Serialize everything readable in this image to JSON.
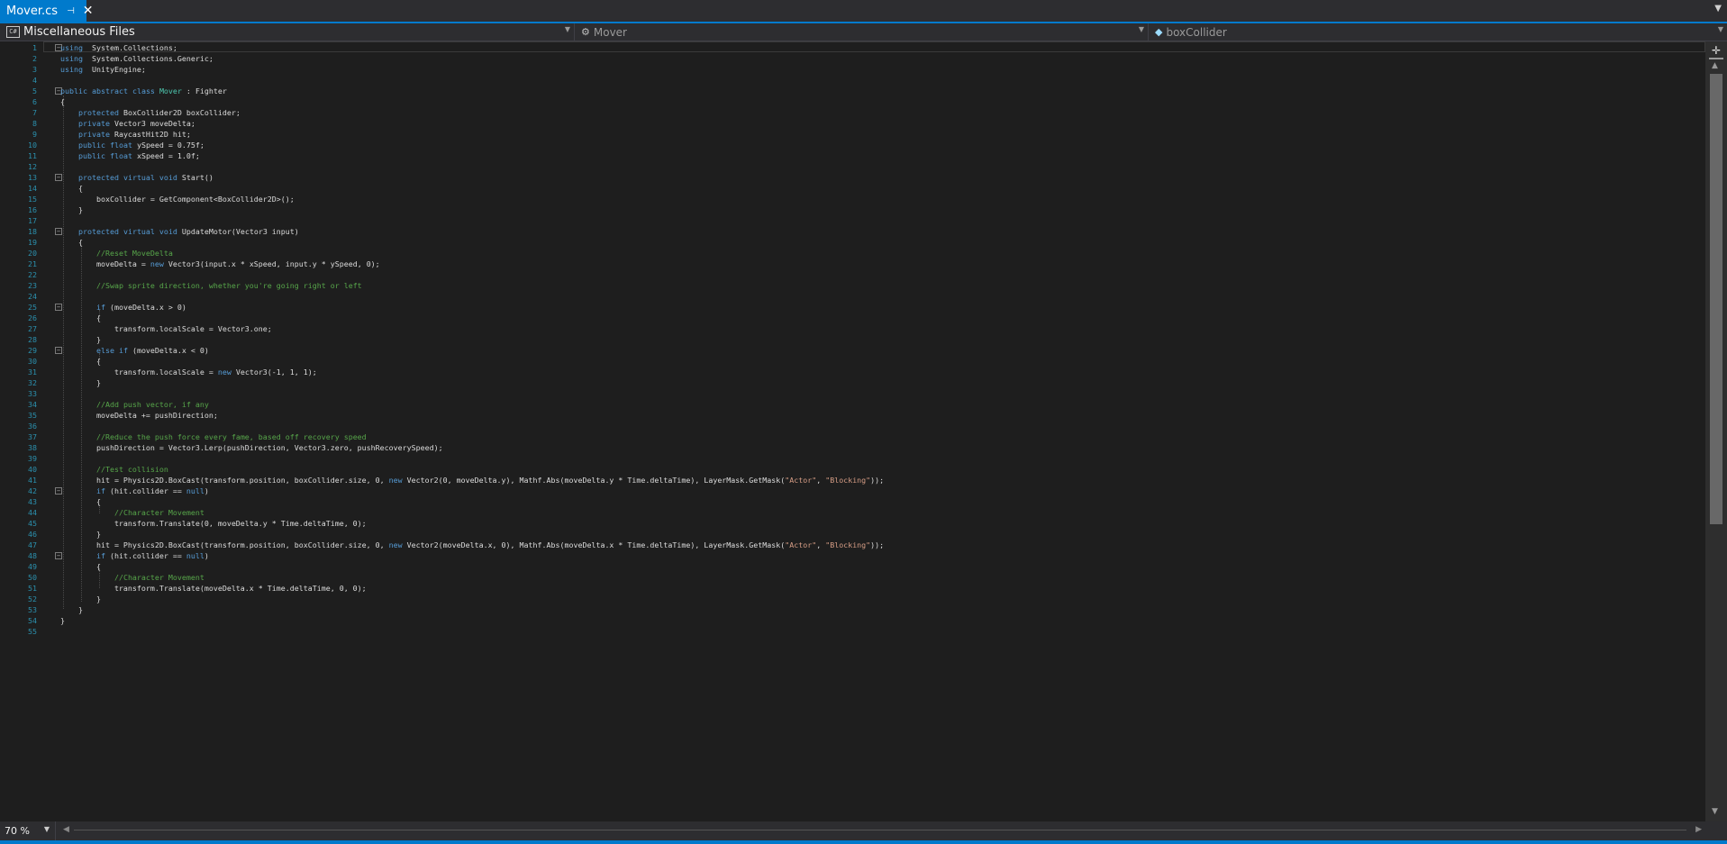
{
  "tab": {
    "title": "Mover.cs",
    "pin_icon": "pin-icon",
    "close_icon": "close-icon"
  },
  "nav": {
    "project": "Miscellaneous Files",
    "type": "Mover",
    "member": "boxCollider"
  },
  "zoom": {
    "value": "70 %"
  },
  "code_lines": [
    [
      [
        "kw",
        "using"
      ],
      [
        "",
        "  System.Collections;"
      ]
    ],
    [
      [
        "kw",
        "using"
      ],
      [
        "",
        "  System.Collections.Generic;"
      ]
    ],
    [
      [
        "kw",
        "using"
      ],
      [
        "",
        "  UnityEngine;"
      ]
    ],
    [],
    [
      [
        "kw",
        "public"
      ],
      [
        "",
        " "
      ],
      [
        "kw",
        "abstract"
      ],
      [
        "",
        " "
      ],
      [
        "kw",
        "class"
      ],
      [
        "",
        " "
      ],
      [
        "ty",
        "Mover"
      ],
      [
        "",
        " : Fighter"
      ]
    ],
    [
      [
        "",
        "{"
      ]
    ],
    [
      [
        "",
        "    "
      ],
      [
        "kw",
        "protected"
      ],
      [
        "",
        " BoxCollider2D boxCollider;"
      ]
    ],
    [
      [
        "",
        "    "
      ],
      [
        "kw",
        "private"
      ],
      [
        "",
        " Vector3 moveDelta;"
      ]
    ],
    [
      [
        "",
        "    "
      ],
      [
        "kw",
        "private"
      ],
      [
        "",
        " RaycastHit2D hit;"
      ]
    ],
    [
      [
        "",
        "    "
      ],
      [
        "kw",
        "public"
      ],
      [
        "",
        " "
      ],
      [
        "kw",
        "float"
      ],
      [
        "",
        " ySpeed = 0.75f;"
      ]
    ],
    [
      [
        "",
        "    "
      ],
      [
        "kw",
        "public"
      ],
      [
        "",
        " "
      ],
      [
        "kw",
        "float"
      ],
      [
        "",
        " xSpeed = 1.0f;"
      ]
    ],
    [],
    [
      [
        "",
        "    "
      ],
      [
        "kw",
        "protected"
      ],
      [
        "",
        " "
      ],
      [
        "kw",
        "virtual"
      ],
      [
        "",
        " "
      ],
      [
        "kw",
        "void"
      ],
      [
        "",
        " Start()"
      ]
    ],
    [
      [
        "",
        "    {"
      ]
    ],
    [
      [
        "",
        "        boxCollider = GetComponent<BoxCollider2D>();"
      ]
    ],
    [
      [
        "",
        "    }"
      ]
    ],
    [],
    [
      [
        "",
        "    "
      ],
      [
        "kw",
        "protected"
      ],
      [
        "",
        " "
      ],
      [
        "kw",
        "virtual"
      ],
      [
        "",
        " "
      ],
      [
        "kw",
        "void"
      ],
      [
        "",
        " UpdateMotor(Vector3 input)"
      ]
    ],
    [
      [
        "",
        "    {"
      ]
    ],
    [
      [
        "",
        "        "
      ],
      [
        "cm",
        "//Reset MoveDelta"
      ]
    ],
    [
      [
        "",
        "        moveDelta = "
      ],
      [
        "kw",
        "new"
      ],
      [
        "",
        " Vector3(input.x * xSpeed, input.y * ySpeed, 0);"
      ]
    ],
    [],
    [
      [
        "",
        "        "
      ],
      [
        "cm",
        "//Swap sprite direction, whether you're going right or left"
      ]
    ],
    [],
    [
      [
        "",
        "        "
      ],
      [
        "kw",
        "if"
      ],
      [
        "",
        " (moveDelta.x > 0)"
      ]
    ],
    [
      [
        "",
        "        {"
      ]
    ],
    [
      [
        "",
        "            transform.localScale = Vector3.one;"
      ]
    ],
    [
      [
        "",
        "        }"
      ]
    ],
    [
      [
        "",
        "        "
      ],
      [
        "kw",
        "else"
      ],
      [
        "",
        " "
      ],
      [
        "kw",
        "if"
      ],
      [
        "",
        " (moveDelta.x < 0)"
      ]
    ],
    [
      [
        "",
        "        {"
      ]
    ],
    [
      [
        "",
        "            transform.localScale = "
      ],
      [
        "kw",
        "new"
      ],
      [
        "",
        " Vector3(-1, 1, 1);"
      ]
    ],
    [
      [
        "",
        "        }"
      ]
    ],
    [],
    [
      [
        "",
        "        "
      ],
      [
        "cm",
        "//Add push vector, if any"
      ]
    ],
    [
      [
        "",
        "        moveDelta += pushDirection;"
      ]
    ],
    [],
    [
      [
        "",
        "        "
      ],
      [
        "cm",
        "//Reduce the push force every fame, based off recovery speed"
      ]
    ],
    [
      [
        "",
        "        pushDirection = Vector3.Lerp(pushDirection, Vector3.zero, pushRecoverySpeed);"
      ]
    ],
    [],
    [
      [
        "",
        "        "
      ],
      [
        "cm",
        "//Test collision"
      ]
    ],
    [
      [
        "",
        "        hit = Physics2D.BoxCast(transform.position, boxCollider.size, 0, "
      ],
      [
        "kw",
        "new"
      ],
      [
        "",
        " Vector2(0, moveDelta.y), Mathf.Abs(moveDelta.y * Time.deltaTime), LayerMask.GetMask("
      ],
      [
        "st",
        "\"Actor\""
      ],
      [
        "",
        ", "
      ],
      [
        "st",
        "\"Blocking\""
      ],
      [
        "",
        "));"
      ]
    ],
    [
      [
        "",
        "        "
      ],
      [
        "kw",
        "if"
      ],
      [
        "",
        " (hit.collider == "
      ],
      [
        "kw",
        "null"
      ],
      [
        "",
        ")"
      ]
    ],
    [
      [
        "",
        "        {"
      ]
    ],
    [
      [
        "",
        "            "
      ],
      [
        "cm",
        "//Character Movement"
      ]
    ],
    [
      [
        "",
        "            transform.Translate(0, moveDelta.y * Time.deltaTime, 0);"
      ]
    ],
    [
      [
        "",
        "        }"
      ]
    ],
    [
      [
        "",
        "        hit = Physics2D.BoxCast(transform.position, boxCollider.size, 0, "
      ],
      [
        "kw",
        "new"
      ],
      [
        "",
        " Vector2(moveDelta.x, 0), Mathf.Abs(moveDelta.x * Time.deltaTime), LayerMask.GetMask("
      ],
      [
        "st",
        "\"Actor\""
      ],
      [
        "",
        ", "
      ],
      [
        "st",
        "\"Blocking\""
      ],
      [
        "",
        "));"
      ]
    ],
    [
      [
        "",
        "        "
      ],
      [
        "kw",
        "if"
      ],
      [
        "",
        " (hit.collider == "
      ],
      [
        "kw",
        "null"
      ],
      [
        "",
        ")"
      ]
    ],
    [
      [
        "",
        "        {"
      ]
    ],
    [
      [
        "",
        "            "
      ],
      [
        "cm",
        "//Character Movement"
      ]
    ],
    [
      [
        "",
        "            transform.Translate(moveDelta.x * Time.deltaTime, 0, 0);"
      ]
    ],
    [
      [
        "",
        "        }"
      ]
    ],
    [
      [
        "",
        "    }"
      ]
    ],
    [
      [
        "",
        "}"
      ]
    ],
    []
  ],
  "fold_lines": [
    1,
    5,
    13,
    18,
    25,
    29,
    42,
    48
  ]
}
